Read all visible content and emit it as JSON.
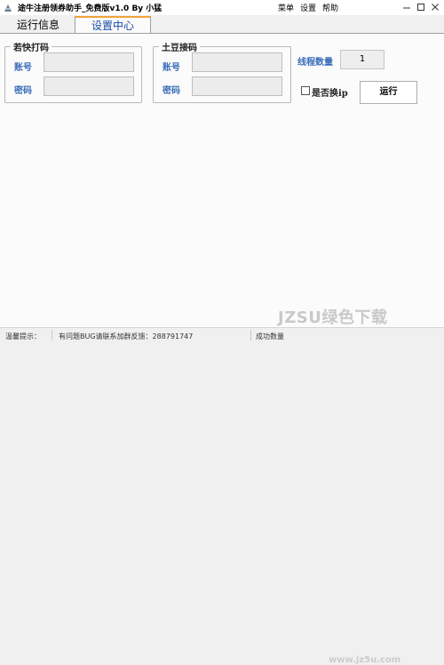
{
  "window": {
    "title": "途牛注册领券助手_免费版v1.0    By 小猛",
    "icon": "app-icon"
  },
  "menu": {
    "items": [
      "菜单",
      "设置",
      "帮助"
    ]
  },
  "tabs": {
    "run": "运行信息",
    "settings": "设置中心",
    "active": "设置中心"
  },
  "group_kuai": {
    "legend": "若快打码",
    "account_label": "账号",
    "account_value": "",
    "password_label": "密码",
    "password_value": ""
  },
  "group_tudou": {
    "legend": "土豆接码",
    "account_label": "账号",
    "account_value": "",
    "password_label": "密码",
    "password_value": ""
  },
  "threads": {
    "label": "线程数量",
    "value": "1"
  },
  "switch_ip": {
    "label": "是否换ip",
    "checked": false
  },
  "run_button": "运行",
  "status": {
    "prompt_label": "温馨提示：",
    "message": "有问题BUG请联系加群反馈：288791747",
    "success_label": "成功数量"
  },
  "watermark": {
    "main": "JZSU绿色下载",
    "sub": "www.jz5u.com"
  },
  "colors": {
    "active_tab_accent": "#f2a23a",
    "label_blue": "#3a6db8",
    "active_tab_text": "#1a4aa6"
  }
}
